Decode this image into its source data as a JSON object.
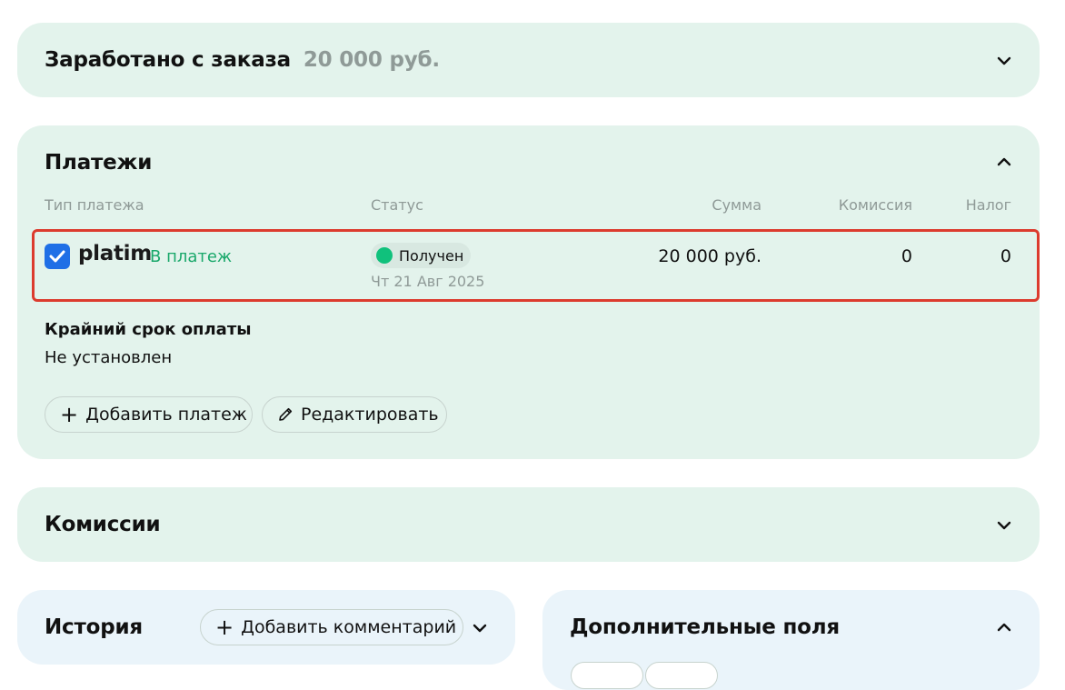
{
  "earned": {
    "title": "Заработано с заказа",
    "amount": "20 000 руб."
  },
  "payments": {
    "title": "Платежи",
    "columns": {
      "type": "Тип платежа",
      "status": "Статус",
      "sum": "Сумма",
      "commission": "Комиссия",
      "tax": "Налог"
    },
    "row": {
      "brand": "platim",
      "link": "В платеж",
      "status": "Получен",
      "date": "Чт 21 Авг 2025",
      "sum": "20 000 руб.",
      "commission": "0",
      "tax": "0"
    },
    "deadline_label": "Крайний срок оплаты",
    "deadline_value": "Не установлен",
    "add_payment_label": "Добавить платеж",
    "edit_label": "Редактировать"
  },
  "commissions": {
    "title": "Комиссии"
  },
  "history": {
    "title": "История",
    "add_comment_label": "Добавить комментарий"
  },
  "extra_fields": {
    "title": "Дополнительные поля"
  },
  "colors": {
    "card_green": "#e3f3ec",
    "card_blue": "#eaf4fa",
    "accent_green": "#10c17c",
    "link_green": "#1aa86b",
    "highlight_red": "#dc3b2e",
    "brand_blue": "#1f6fe6"
  },
  "icons": {
    "brand_logo": "checkbox-check-icon",
    "collapse": "chevron-up-icon",
    "expand": "chevron-down-icon",
    "add": "plus-icon",
    "edit": "pencil-icon"
  }
}
